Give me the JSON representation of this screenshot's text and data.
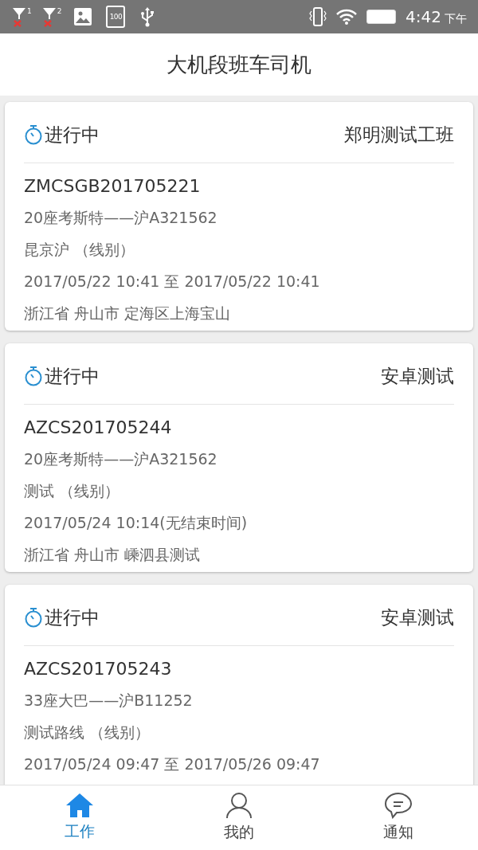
{
  "status_bar": {
    "sim_slots": [
      "1",
      "2"
    ],
    "storage_label": "100",
    "time": "4:42",
    "period": "下午"
  },
  "header": {
    "title": "大机段班车司机"
  },
  "trips": [
    {
      "status": "进行中",
      "team": "郑明测试工班",
      "code": "ZMCSGB201705221",
      "vehicle": "20座考斯特——沪A321562",
      "route": "昆京沪 （线别）",
      "time": "2017/05/22 10:41 至 2017/05/22 10:41",
      "address": "浙江省 舟山市 定海区上海宝山"
    },
    {
      "status": "进行中",
      "team": "安卓测试",
      "code": "AZCS201705244",
      "vehicle": "20座考斯特——沪A321562",
      "route": "测试 （线别）",
      "time": "2017/05/24 10:14(无结束时间)",
      "address": "浙江省 舟山市 嵊泗县测试"
    },
    {
      "status": "进行中",
      "team": "安卓测试",
      "code": "AZCS201705243",
      "vehicle": "33座大巴——沪B11252",
      "route": "测试路线 （线别）",
      "time": "2017/05/24 09:47 至 2017/05/26 09:47"
    }
  ],
  "bottom_nav": [
    {
      "kind": "home",
      "label": "工作",
      "selected": true
    },
    {
      "kind": "person",
      "label": "我的",
      "selected": false
    },
    {
      "kind": "chat",
      "label": "通知",
      "selected": false
    }
  ]
}
